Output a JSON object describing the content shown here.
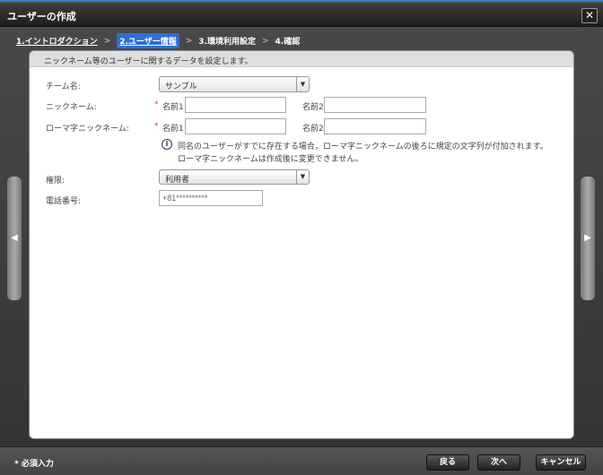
{
  "window": {
    "title": "ユーザーの作成",
    "close_label": "✕"
  },
  "steps": [
    {
      "label": "1.イントロダクション"
    },
    {
      "label": "2.ユーザー情報"
    },
    {
      "label": "3.環境利用設定"
    },
    {
      "label": "4.確認"
    }
  ],
  "step_separator": ">",
  "panel": {
    "description": "ニックネーム等のユーザーに関するデータを設定します。"
  },
  "form": {
    "team": {
      "label": "チーム名:",
      "value": "サンプル"
    },
    "nickname": {
      "label": "ニックネーム:",
      "name1_label": "名前1",
      "name2_label": "名前2",
      "name1_value": "",
      "name2_value": ""
    },
    "romaji": {
      "label": "ローマ字ニックネーム:",
      "name1_label": "名前1",
      "name2_label": "名前2",
      "name1_value": "",
      "name2_value": ""
    },
    "info_lines": [
      "同名のユーザーがすでに存在する場合，ローマ字ニックネームの後ろに規定の文字列が付加されます。",
      "ローマ字ニックネームは作成後に変更できません。"
    ],
    "role": {
      "label": "権限:",
      "value": "利用者"
    },
    "phone": {
      "label": "電話番号:",
      "value": "+81**********"
    },
    "required_mark": "*"
  },
  "nav": {
    "prev": "◀",
    "next": "▶"
  },
  "footer": {
    "required_note": "* 必須入力",
    "back": "戻る",
    "next": "次へ",
    "cancel": "キャンセル"
  },
  "colors": {
    "accent": "#2d6fd6",
    "required": "#c04070"
  }
}
